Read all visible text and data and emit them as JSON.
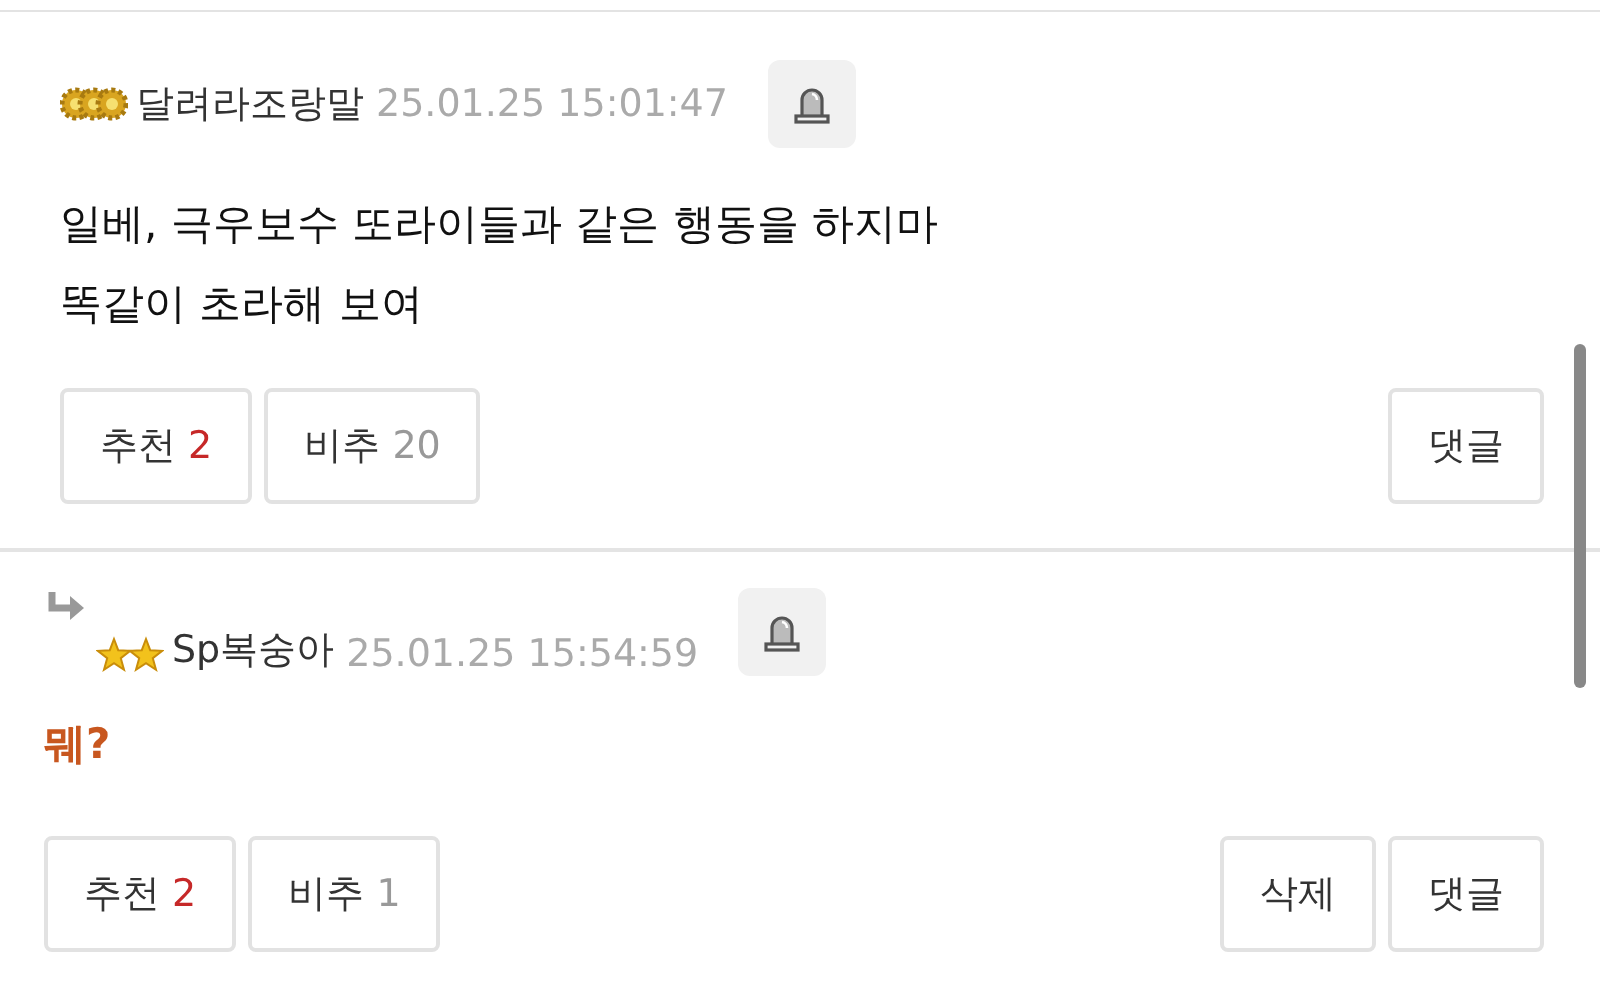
{
  "comments": [
    {
      "reply": false,
      "badge": {
        "kind": "gears"
      },
      "author": "달려라조랑말",
      "time": "25.01.25 15:01:47",
      "emphasis": false,
      "body": [
        "일베, 극우보수 또라이들과 같은 행동을 하지마",
        "똑같이 초라해 보여"
      ],
      "votes": [
        {
          "kind": "up",
          "label": "추천",
          "count": "2"
        },
        {
          "kind": "down",
          "label": "비추",
          "count": "20"
        }
      ],
      "actions": [
        "댓글"
      ]
    },
    {
      "reply": true,
      "badge": {
        "kind": "stars"
      },
      "author": "Sp복숭아",
      "time": "25.01.25 15:54:59",
      "emphasis": true,
      "body": [
        "뭬?"
      ],
      "votes": [
        {
          "kind": "up",
          "label": "추천",
          "count": "2"
        },
        {
          "kind": "down",
          "label": "비추",
          "count": "1"
        }
      ],
      "actions": [
        "삭제",
        "댓글"
      ]
    }
  ]
}
